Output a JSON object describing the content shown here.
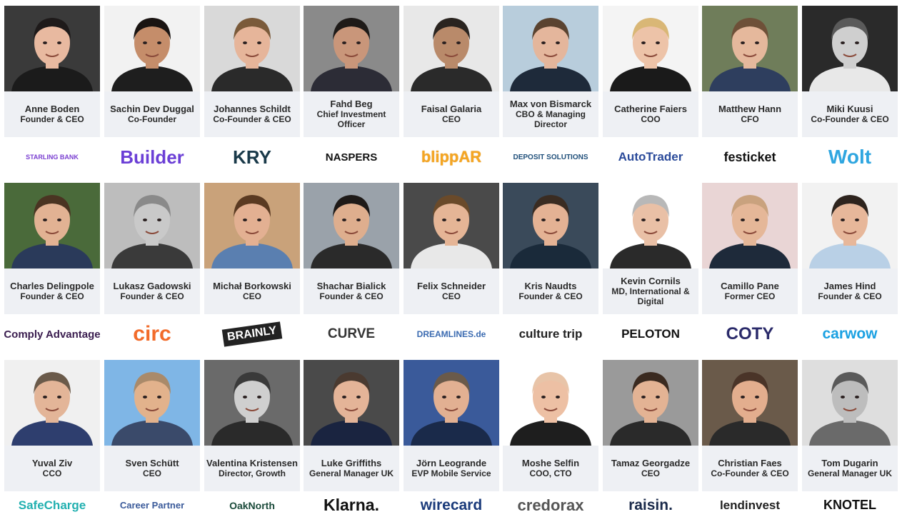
{
  "people": [
    {
      "name": "Anne Boden",
      "role": "Founder & CEO",
      "company": "STARLING BANK",
      "bg": "#3a3a3a",
      "skin": "#e8b9a0",
      "hair": "#1e1a1a",
      "shirt": "#1b1b1b",
      "logo_color": "#7a3fd1",
      "logo_size": "9px",
      "icon": "starling-bank-logo"
    },
    {
      "name": "Sachin Dev Duggal",
      "role": "Co-Founder",
      "company": "Builder",
      "bg": "#f2f2f2",
      "skin": "#c58d6a",
      "hair": "#1a1412",
      "shirt": "#1e1e1e",
      "logo_color": "#6b3fd6",
      "logo_size": "26px",
      "icon": "builder-logo"
    },
    {
      "name": "Johannes Schildt",
      "role": "Co-Founder & CEO",
      "company": "KRY",
      "bg": "#d9d9d9",
      "skin": "#e6b59a",
      "hair": "#7a5a3a",
      "shirt": "#2a2a2a",
      "logo_color": "#1a3a4a",
      "logo_size": "26px",
      "icon": "kry-logo"
    },
    {
      "name": "Fahd Beg",
      "role": "Chief Investment Officer",
      "company": "NASPERS",
      "bg": "#8a8a8a",
      "skin": "#c9967a",
      "hair": "#1e1a18",
      "shirt": "#2c2c36",
      "logo_color": "#111111",
      "logo_size": "15px",
      "icon": "naspers-logo"
    },
    {
      "name": "Faisal Galaria",
      "role": "CEO",
      "company": "blippAR",
      "bg": "#e8e8e8",
      "skin": "#b98a6a",
      "hair": "#2a2420",
      "shirt": "#2a2a2a",
      "logo_color": "#f5a623",
      "logo_size": "22px",
      "icon": "blippar-logo"
    },
    {
      "name": "Max von Bismarck",
      "role": "CBO & Managing Director",
      "company": "DEPOSIT SOLUTIONS",
      "bg": "#b8cddc",
      "skin": "#e4b69c",
      "hair": "#5a4330",
      "shirt": "#1e2a3a",
      "logo_color": "#1f4f7a",
      "logo_size": "10px",
      "icon": "deposit-solutions-logo"
    },
    {
      "name": "Catherine Faiers",
      "role": "COO",
      "company": "AutoTrader",
      "bg": "#f4f4f4",
      "skin": "#edc3a8",
      "hair": "#d9b776",
      "shirt": "#1a1a1a",
      "logo_color": "#2a4a9a",
      "logo_size": "17px",
      "icon": "autotrader-logo"
    },
    {
      "name": "Matthew Hann",
      "role": "CFO",
      "company": "festicket",
      "bg": "#6f7d5a",
      "skin": "#e5b89c",
      "hair": "#6e5038",
      "shirt": "#2e3e5e",
      "logo_color": "#111111",
      "logo_size": "18px",
      "icon": "festicket-logo"
    },
    {
      "name": "Miki Kuusi",
      "role": "Co-Founder & CEO",
      "company": "Wolt",
      "bg": "#2a2a2a",
      "skin": "#cfcfcf",
      "hair": "#5a5a5a",
      "shirt": "#e8e8e8",
      "logo_color": "#2fa6e0",
      "logo_size": "28px",
      "icon": "wolt-logo"
    },
    {
      "name": "Charles Delingpole",
      "role": "Founder & CEO",
      "company": "Comply Advantage",
      "bg": "#4a6a3a",
      "skin": "#e2b293",
      "hair": "#4a3422",
      "shirt": "#2a3a5a",
      "logo_color": "#3a1d4f",
      "logo_size": "15px",
      "icon": "comply-advantage-logo"
    },
    {
      "name": "Lukasz Gadowski",
      "role": "Founder & CEO",
      "company": "circ",
      "bg": "#bdbdbd",
      "skin": "#c9c9c9",
      "hair": "#8a8a8a",
      "shirt": "#3a3a3a",
      "logo_color": "#f26b2a",
      "logo_size": "30px",
      "icon": "circ-logo"
    },
    {
      "name": "Michał Borkowski",
      "role": "CEO",
      "company": "BRAINLY",
      "bg": "#c9a27a",
      "skin": "#e3b092",
      "hair": "#5a3a22",
      "shirt": "#5a7fb0",
      "logo_color": "#ffffff",
      "logo_size": "16px",
      "icon": "brainly-logo"
    },
    {
      "name": "Shachar Bialick",
      "role": "Founder & CEO",
      "company": "CURVE",
      "bg": "#9aa2aa",
      "skin": "#deae8e",
      "hair": "#1e1a18",
      "shirt": "#2a2a2a",
      "logo_color": "#333333",
      "logo_size": "19px",
      "icon": "curve-logo"
    },
    {
      "name": "Felix Schneider",
      "role": "CEO",
      "company": "DREAMLINES.de",
      "bg": "#4a4a4a",
      "skin": "#e5b596",
      "hair": "#6a4a2a",
      "shirt": "#e8e8e8",
      "logo_color": "#3a6ab0",
      "logo_size": "12px",
      "icon": "dreamlines-logo"
    },
    {
      "name": "Kris Naudts",
      "role": "Founder & CEO",
      "company": "culture trip",
      "bg": "#3a4a5a",
      "skin": "#e4b294",
      "hair": "#3a2c22",
      "shirt": "#1a2a3a",
      "logo_color": "#222222",
      "logo_size": "17px",
      "icon": "culture-trip-logo"
    },
    {
      "name": "Kevin Cornils",
      "role": "MD, International & Digital",
      "company": "PELOTON",
      "bg": "#ffffff",
      "skin": "#e9c0a6",
      "hair": "#b8b8b8",
      "shirt": "#2a2a2a",
      "logo_color": "#111111",
      "logo_size": "17px",
      "icon": "peloton-logo"
    },
    {
      "name": "Camillo Pane",
      "role": "Former CEO",
      "company": "COTY",
      "bg": "#e9d5d5",
      "skin": "#e5b798",
      "hair": "#c9a27e",
      "shirt": "#1e2a3a",
      "logo_color": "#2a2a6a",
      "logo_size": "24px",
      "icon": "coty-logo"
    },
    {
      "name": "James Hind",
      "role": "Founder & CEO",
      "company": "carwow",
      "bg": "#f2f2f2",
      "skin": "#e7b79a",
      "hair": "#2e241e",
      "shirt": "#b9d0e6",
      "logo_color": "#1ba1e2",
      "logo_size": "21px",
      "icon": "carwow-logo"
    },
    {
      "name": "Yuval Ziv",
      "role": "CCO",
      "company": "SafeCharge",
      "bg": "#f0f0f0",
      "skin": "#e3b598",
      "hair": "#6a5a4a",
      "shirt": "#2e3e6e",
      "logo_color": "#22b0b0",
      "logo_size": "17px",
      "icon": "safecharge-logo"
    },
    {
      "name": "Sven Schütt",
      "role": "CEO",
      "company": "Career Partner",
      "bg": "#7fb6e6",
      "skin": "#e2b28c",
      "hair": "#a98a6a",
      "shirt": "#3a4a6a",
      "logo_color": "#3a5a9a",
      "logo_size": "13px",
      "icon": "career-partner-logo"
    },
    {
      "name": "Valentina Kristensen",
      "role": "Director, Growth",
      "company": "OakNorth",
      "bg": "#6a6a6a",
      "skin": "#cfcfcf",
      "hair": "#3a3a3a",
      "shirt": "#2a2a2a",
      "logo_color": "#1a4a3a",
      "logo_size": "14px",
      "icon": "oaknorth-logo"
    },
    {
      "name": "Luke Griffiths",
      "role": "General Manager UK",
      "company": "Klarna.",
      "bg": "#4a4a4a",
      "skin": "#e4b498",
      "hair": "#4a3a30",
      "shirt": "#1a2440",
      "logo_color": "#111111",
      "logo_size": "23px",
      "icon": "klarna-logo"
    },
    {
      "name": "Jörn Leogrande",
      "role": "EVP Mobile Service",
      "company": "wirecard",
      "bg": "#3a5a9a",
      "skin": "#e2b092",
      "hair": "#6a5a4a",
      "shirt": "#1a2a4a",
      "logo_color": "#1a3a7a",
      "logo_size": "21px",
      "icon": "wirecard-logo"
    },
    {
      "name": "Moshe Selfin",
      "role": "COO, CTO",
      "company": "credorax",
      "bg": "#ffffff",
      "skin": "#edc0a4",
      "hair": "#e8c4a8",
      "shirt": "#1e1e1e",
      "logo_color": "#555555",
      "logo_size": "22px",
      "icon": "credorax-logo"
    },
    {
      "name": "Tamaz Georgadze",
      "role": "CEO",
      "company": "raisin.",
      "bg": "#9a9a9a",
      "skin": "#e3b394",
      "hair": "#3a2a20",
      "shirt": "#2a2a2a",
      "logo_color": "#1a2a4a",
      "logo_size": "21px",
      "icon": "raisin-logo"
    },
    {
      "name": "Christian Faes",
      "role": "Co-Founder & CEO",
      "company": "lendinvest",
      "bg": "#6a5a4a",
      "skin": "#e3ae8e",
      "hair": "#4a3428",
      "shirt": "#2a2a2a",
      "logo_color": "#222222",
      "logo_size": "17px",
      "icon": "lendinvest-logo"
    },
    {
      "name": "Tom Dugarin",
      "role": "General Manager UK",
      "company": "KNOTEL",
      "bg": "#dedede",
      "skin": "#bdbdbd",
      "hair": "#5a5a5a",
      "shirt": "#6a6a6a",
      "logo_color": "#111111",
      "logo_size": "18px",
      "icon": "knotel-logo"
    }
  ]
}
